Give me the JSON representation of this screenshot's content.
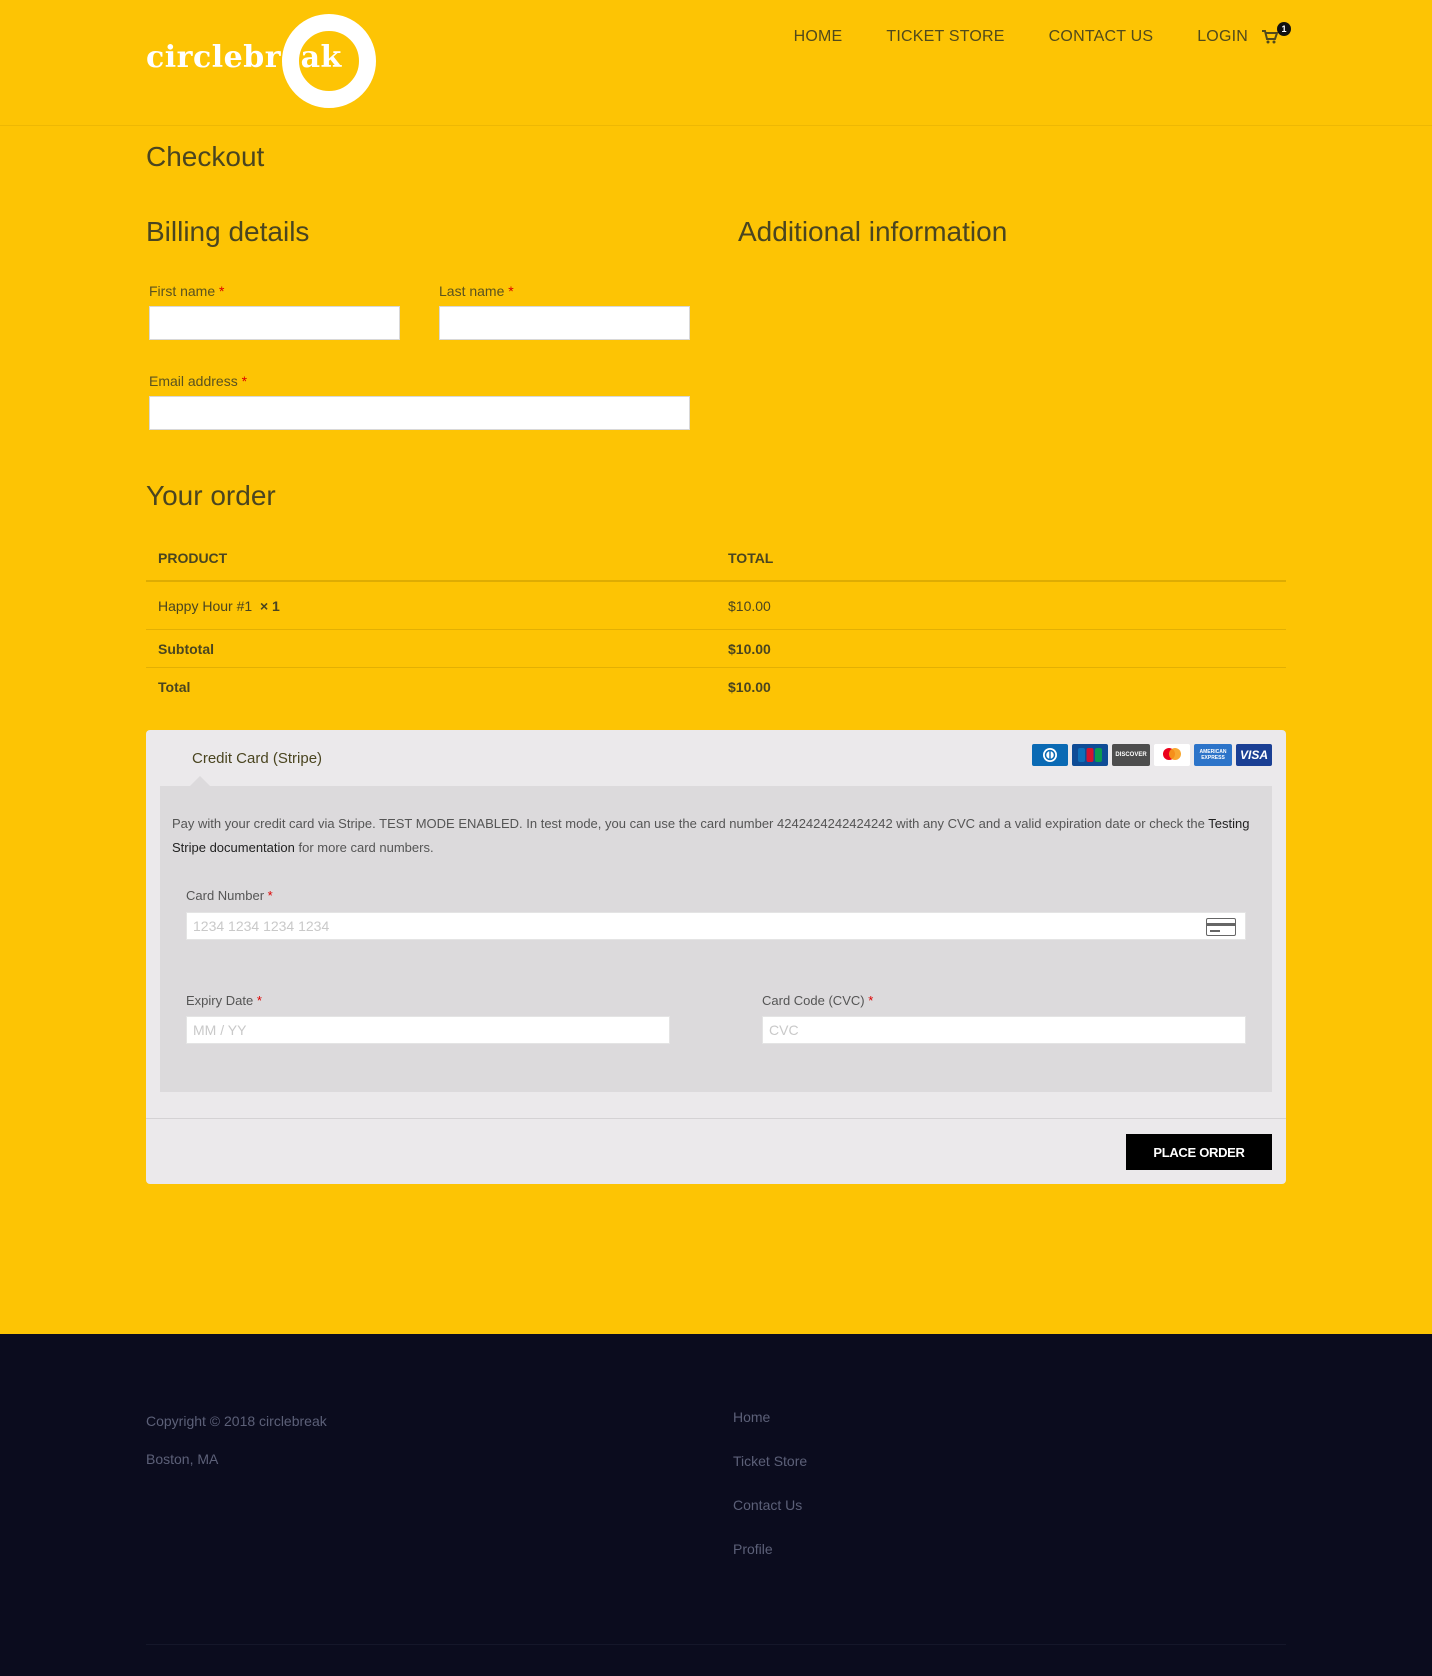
{
  "brand": {
    "name": "circlebreak"
  },
  "nav": {
    "items": [
      {
        "label": "HOME"
      },
      {
        "label": "TICKET STORE"
      },
      {
        "label": "CONTACT US"
      },
      {
        "label": "LOGIN"
      }
    ],
    "cart_count": "1"
  },
  "page": {
    "title": "Checkout"
  },
  "billing": {
    "heading": "Billing details",
    "first_name_label": "First name",
    "last_name_label": "Last name",
    "email_label": "Email address",
    "required_marker": "*",
    "first_name_value": "",
    "last_name_value": "",
    "email_value": ""
  },
  "additional": {
    "heading": "Additional information"
  },
  "order": {
    "heading": "Your order",
    "columns": [
      "PRODUCT",
      "TOTAL"
    ],
    "item": {
      "name": "Happy Hour #1",
      "qty": "× 1",
      "total": "$10.00"
    },
    "subtotal_label": "Subtotal",
    "subtotal_value": "$10.00",
    "total_label": "Total",
    "total_value": "$10.00"
  },
  "payment": {
    "method_label": "Credit Card (Stripe)",
    "card_brands": [
      "Diners Club",
      "JCB",
      "DISCOVER",
      "Mastercard",
      "AMERICAN EXPRESS",
      "VISA"
    ],
    "description_prefix": "Pay with your credit card via Stripe. TEST MODE ENABLED. In test mode, you can use the card number 4242424242424242 with any CVC and a valid expiration date or check the",
    "description_link": "Testing Stripe documentation",
    "description_suffix": "for more card numbers.",
    "card_number_label": "Card Number",
    "card_number_placeholder": "1234 1234 1234 1234",
    "expiry_label": "Expiry Date",
    "expiry_placeholder": "MM / YY",
    "cvc_label": "Card Code (CVC)",
    "cvc_placeholder": "CVC",
    "place_order_label": "PLACE ORDER"
  },
  "footer": {
    "copyright": "Copyright © 2018 circlebreak",
    "location": "Boston, MA",
    "links": [
      {
        "label": "Home"
      },
      {
        "label": "Ticket Store"
      },
      {
        "label": "Contact Us"
      },
      {
        "label": "Profile"
      }
    ]
  },
  "colors": {
    "background": "#fdc404",
    "footer": "#0b0c1e",
    "button": "#000000",
    "panel": "#ebe9eb"
  }
}
